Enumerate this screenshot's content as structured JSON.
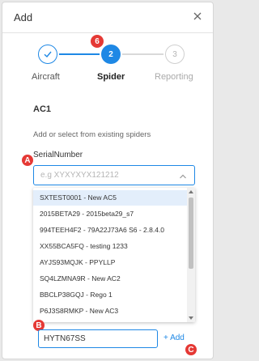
{
  "dialog": {
    "title": "Add"
  },
  "stepper": {
    "steps": [
      {
        "label": "Aircraft",
        "state": "done",
        "number": ""
      },
      {
        "label": "Spider",
        "state": "active",
        "number": "2"
      },
      {
        "label": "Reporting",
        "state": "pending",
        "number": "3"
      }
    ],
    "accent_color": "#1e88e5"
  },
  "annotations": {
    "badge_stepper": "6",
    "badge_field": "A",
    "badge_add_input": "B",
    "badge_add_button": "C"
  },
  "form": {
    "section_title": "AC1",
    "helper_text": "Add or select from existing spiders",
    "field_label": "SerialNumber",
    "select_placeholder": "e.g XYXYXYX121212",
    "options": [
      "SXTEST0001 - New AC5",
      "2015BETA29 - 2015beta29_s7",
      "994TEEH4F2 - 79A22J73A6 S6 - 2.8.4.0",
      "XX55BCA5FQ - testing 1233",
      "AYJS93MQJK - PPYLLP",
      "SQ4LZMNA9R - New AC2",
      "BBCLP38GQJ - Rego 1",
      "P6J3S8RMKP - New AC3"
    ],
    "add_input_value": "HYTN67SS",
    "add_button_label": "+ Add"
  }
}
